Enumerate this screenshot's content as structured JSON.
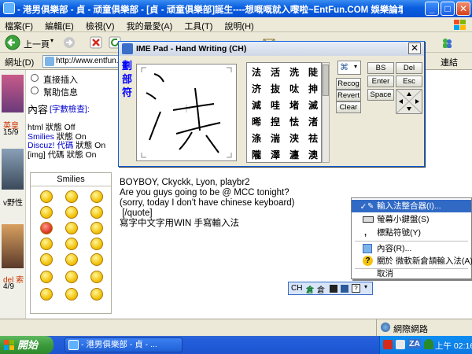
{
  "window": {
    "title": "- 港男俱樂部 - 貞 - 顽童俱樂部 - [貞 - 顽童俱樂部]誕生----想嘅嘅就入嚟啦~EntFun.COM 娛樂論壇 - Microsoft Internet Explorer",
    "minimize_label": "_",
    "maximize_label": "□",
    "close_label": "✕"
  },
  "menu": {
    "items": [
      "檔案(F)",
      "編輯(E)",
      "檢視(V)",
      "我的最愛(A)",
      "工具(T)",
      "說明(H)"
    ]
  },
  "toolbar": {
    "back_label": "上一頁",
    "links_label": "連結"
  },
  "address": {
    "label": "網址(D)",
    "value": "http://www.entfun.com/bb"
  },
  "forum": {
    "left_labels": [
      "英皇",
      "15/9",
      "v野性",
      "del 索",
      "4/9"
    ],
    "options": [
      "直接插入",
      "幫助信息"
    ],
    "content_label": "內容",
    "content_link": "[字數檢查]:",
    "status_lines": [
      {
        "name": "html",
        "state": "狀態 Off",
        "color": "#000000"
      },
      {
        "name": "Smilies",
        "state": "狀態 On",
        "color": "#0000cc"
      },
      {
        "name": "Discuz! 代碼",
        "state": "狀態 On",
        "color": "#0000cc"
      },
      {
        "name": "[img] 代碼",
        "state": "狀態 On",
        "color": "#000000"
      }
    ],
    "smilies_title": "Smilies"
  },
  "ime": {
    "title": "IME Pad - Hand Writing (CH)",
    "close_label": "✕",
    "side_chars": [
      "劃",
      "部",
      "符"
    ],
    "candidates": [
      [
        "法",
        "活",
        "洗",
        "陡"
      ],
      [
        "济",
        "抜",
        "呔",
        "抻"
      ],
      [
        "減",
        "哇",
        "堵",
        "滅"
      ],
      [
        "晞",
        "揑",
        "怯",
        "渚"
      ],
      [
        "涤",
        "湍",
        "浃",
        "祛"
      ],
      [
        "隴",
        "澤",
        "瀍",
        "澳"
      ]
    ],
    "buttons": {
      "recog": "Recog",
      "revert": "Revert",
      "clear": "Clear",
      "bs": "BS",
      "del": "Del",
      "enter": "Enter",
      "esc": "Esc",
      "space": "Space"
    }
  },
  "message": {
    "lines": [
      "BOYBOY, Ckyckk, Lyon, playbr2",
      "",
      "Are you guys going to be @ MCC tonight?",
      "(sorry, today I don't have chinese keyboard)",
      " [/quote]",
      "",
      "寫字中文字用WIN 手寫輸入法"
    ]
  },
  "context_menu": {
    "items": [
      {
        "label": "輸入法整合器(I)...",
        "checked": true,
        "highlighted": true
      },
      {
        "label": "螢幕小鍵盤(S)",
        "checked": false,
        "highlighted": false
      },
      {
        "label": "標點符號(Y)",
        "checked": false,
        "highlighted": false
      },
      {
        "label": "內容(R)...",
        "checked": false,
        "highlighted": false
      },
      {
        "label": "關於 微軟新倉頡輸入法(A)...",
        "checked": false,
        "highlighted": false
      },
      {
        "label": "取消",
        "checked": false,
        "highlighted": false
      }
    ]
  },
  "langbar": {
    "lang": "CH",
    "ime_char_1": "倉",
    "ime_char_2": "倉"
  },
  "status": {
    "zone": "網際網路"
  },
  "taskbar": {
    "start_label": "開始",
    "task_label": "- 港男俱樂部 - 貞 - ...",
    "ime_label": "ZA",
    "clock": "上午 02:16"
  },
  "colors": {
    "titlebar": "#0a5ee0",
    "highlight": "#316ac5",
    "link_blue": "#0000cc",
    "ime_side_blue": "#0000ff"
  }
}
